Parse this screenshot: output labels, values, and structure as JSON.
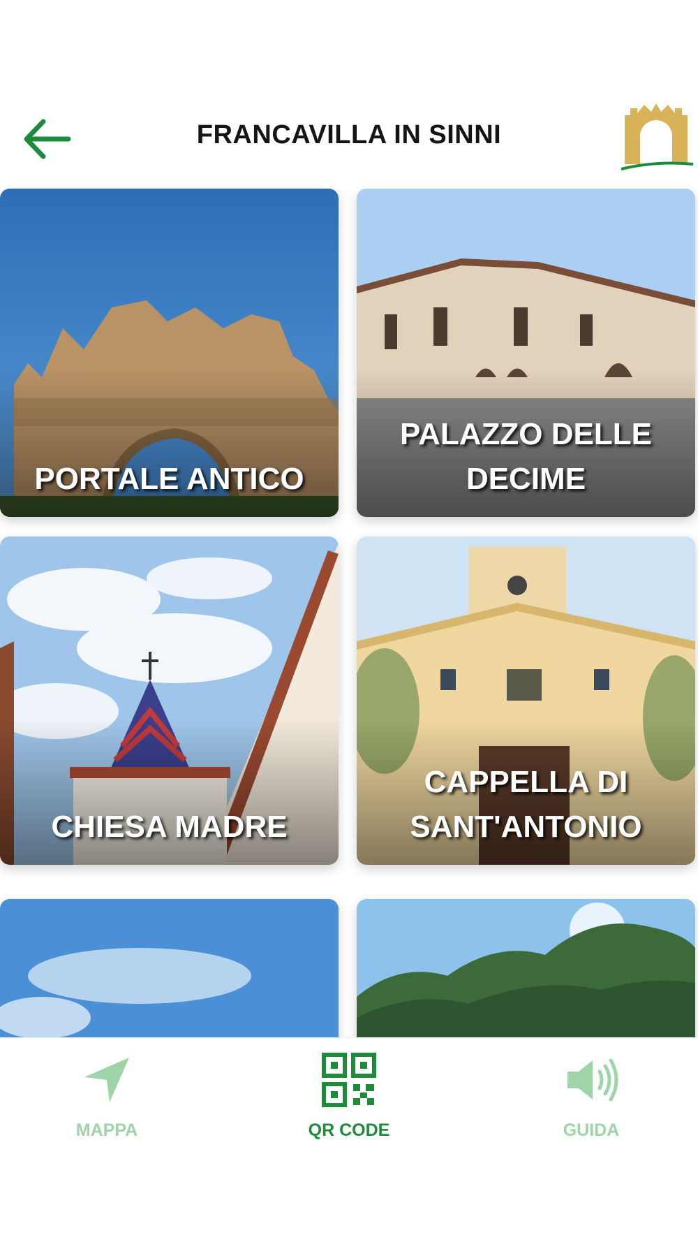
{
  "header": {
    "title": "FRANCAVILLA IN SINNI",
    "back_icon": "arrow-left-icon",
    "logo_icon": "town-gate-logo"
  },
  "tiles": [
    {
      "label": "PORTALE ANTICO"
    },
    {
      "label": "PALAZZO DELLE\nDECIME"
    },
    {
      "label": "CHIESA MADRE"
    },
    {
      "label": "CAPPELLA DI\nSANT'ANTONIO"
    },
    {
      "label": ""
    },
    {
      "label": ""
    }
  ],
  "nav": {
    "items": [
      {
        "label": "MAPPA",
        "icon": "navigation-arrow-icon",
        "active": false
      },
      {
        "label": "QR CODE",
        "icon": "qr-code-icon",
        "active": true
      },
      {
        "label": "GUIDA",
        "icon": "speaker-icon",
        "active": false
      }
    ]
  },
  "colors": {
    "accent": "#1e8a3c",
    "inactive": "#9fd3a8",
    "logo": "#d9b35a"
  }
}
